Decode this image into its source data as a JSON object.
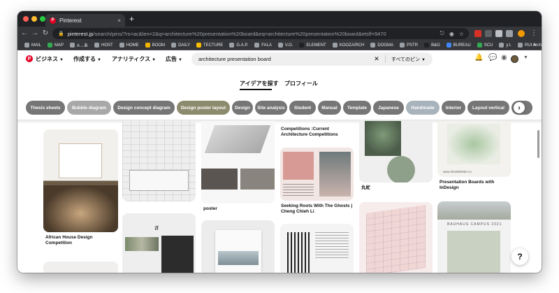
{
  "browser": {
    "tab_title": "Pinterest",
    "tab_close": "×",
    "new_tab": "+",
    "url_host": "pinterest.jp",
    "url_path": "/search/pins/?rs=ac&len=2&q=architecture%20presentation%20board&eq=architecture%20presentation%20board&etslf=9470",
    "nav": {
      "back": "←",
      "forward": "→",
      "reload": "↻"
    },
    "bookmarks": [
      {
        "label": "MAIL",
        "color": "#9aa0a6"
      },
      {
        "label": "MAP",
        "color": "#34a853"
      },
      {
        "label": "A→あ",
        "color": "#9aa0a6"
      },
      {
        "label": "HOST",
        "color": "#9aa0a6"
      },
      {
        "label": "HOME",
        "color": "#9aa0a6"
      },
      {
        "label": "BOOM",
        "color": "#f4b400"
      },
      {
        "label": "DAILY",
        "color": "#9aa0a6"
      },
      {
        "label": "TECTURE",
        "color": "#fbbc04"
      },
      {
        "label": "G.A.P.",
        "color": "#9aa0a6"
      },
      {
        "label": "FALA",
        "color": "#9aa0a6"
      },
      {
        "label": "V.O.",
        "color": "#9aa0a6"
      },
      {
        "label": "ELEMENT",
        "color": "#202124"
      },
      {
        "label": "KOOZA/RCH",
        "color": "#9aa0a6"
      },
      {
        "label": "DOGMA",
        "color": "#9aa0a6"
      },
      {
        "label": "PSTR",
        "color": "#9aa0a6"
      },
      {
        "label": "B&G",
        "color": "#202124"
      },
      {
        "label": "BUREAU",
        "color": "#4285f4"
      },
      {
        "label": "SCU",
        "color": "#34a853"
      },
      {
        "label": "y.t.",
        "color": "#9aa0a6"
      },
      {
        "label": "RUI Architects",
        "color": "#9aa0a6"
      }
    ],
    "bookmarks_more": "»"
  },
  "header": {
    "logo": "P",
    "nav": [
      {
        "label": "ビジネス"
      },
      {
        "label": "作成する"
      },
      {
        "label": "アナリティクス"
      },
      {
        "label": "広告"
      }
    ],
    "search_query": "architecture presentation board",
    "search_clear": "✕",
    "search_scope": "すべてのピン",
    "subtabs": [
      "アイデアを探す",
      "プロフィール"
    ],
    "help": "?"
  },
  "chips": [
    {
      "label": "Thesis sheets",
      "color": "#767676"
    },
    {
      "label": "Bubble diagram",
      "color": "#a8a8a8"
    },
    {
      "label": "Design concept diagram",
      "color": "#767676"
    },
    {
      "label": "Design poster layout",
      "color": "#8d8b6e"
    },
    {
      "label": "Design",
      "color": "#767676"
    },
    {
      "label": "Site analysis",
      "color": "#767676"
    },
    {
      "label": "Student",
      "color": "#767676"
    },
    {
      "label": "Manual",
      "color": "#767676"
    },
    {
      "label": "Template",
      "color": "#767676"
    },
    {
      "label": "Japanese",
      "color": "#767676"
    },
    {
      "label": "Handmade",
      "color": "#a9b3bb"
    },
    {
      "label": "Interior",
      "color": "#767676"
    },
    {
      "label": "Layout vertical",
      "color": "#767676"
    }
  ],
  "chip_next": "›",
  "pins": {
    "p1_title": "African House Design Competition",
    "p3_title": "poster",
    "p4_title_a": "Competitions :Current Architecture Competitions",
    "p4_title_b": "Seeking Roots With The Ghosts | Cheng Chieh Li",
    "p5_title": "丸虻",
    "p6_caption": "www.showitbetter.co",
    "p6_title": "Presentation Boards with InDesign",
    "p6b_caption": "BAUHAUS CAMPUS 2021"
  }
}
